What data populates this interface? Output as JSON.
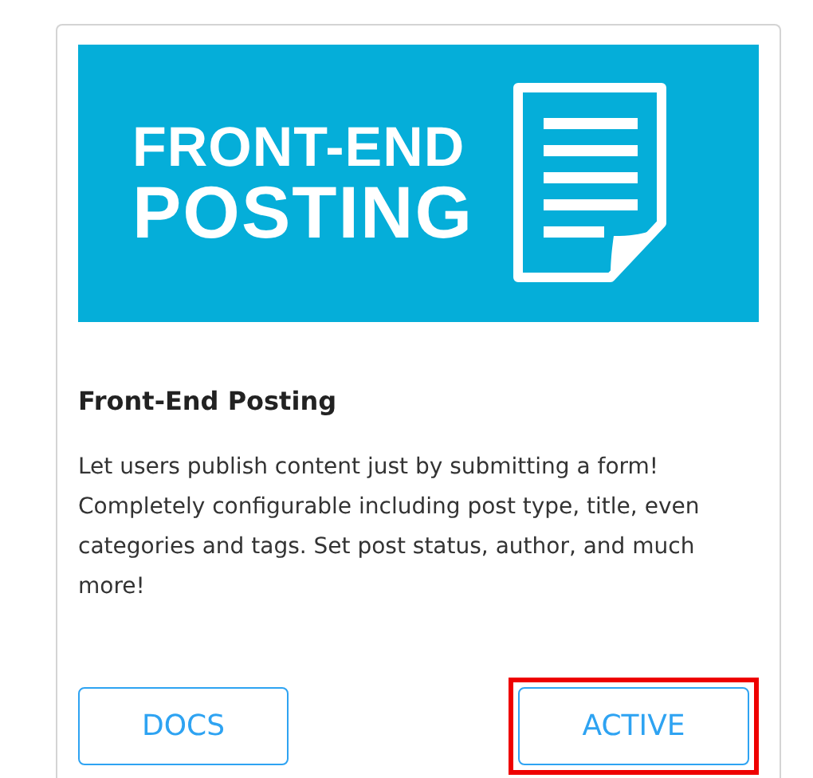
{
  "banner": {
    "lines": [
      "FRONT-END",
      "POSTING"
    ]
  },
  "title": "Front-End Posting",
  "description": "Let users publish content just by submitting a form! Completely configurable including post type, title, even categories and tags. Set post status, author, and much more!",
  "buttons": [
    {
      "label": "DOCS",
      "highlighted": false
    },
    {
      "label": "ACTIVE",
      "highlighted": true
    }
  ]
}
